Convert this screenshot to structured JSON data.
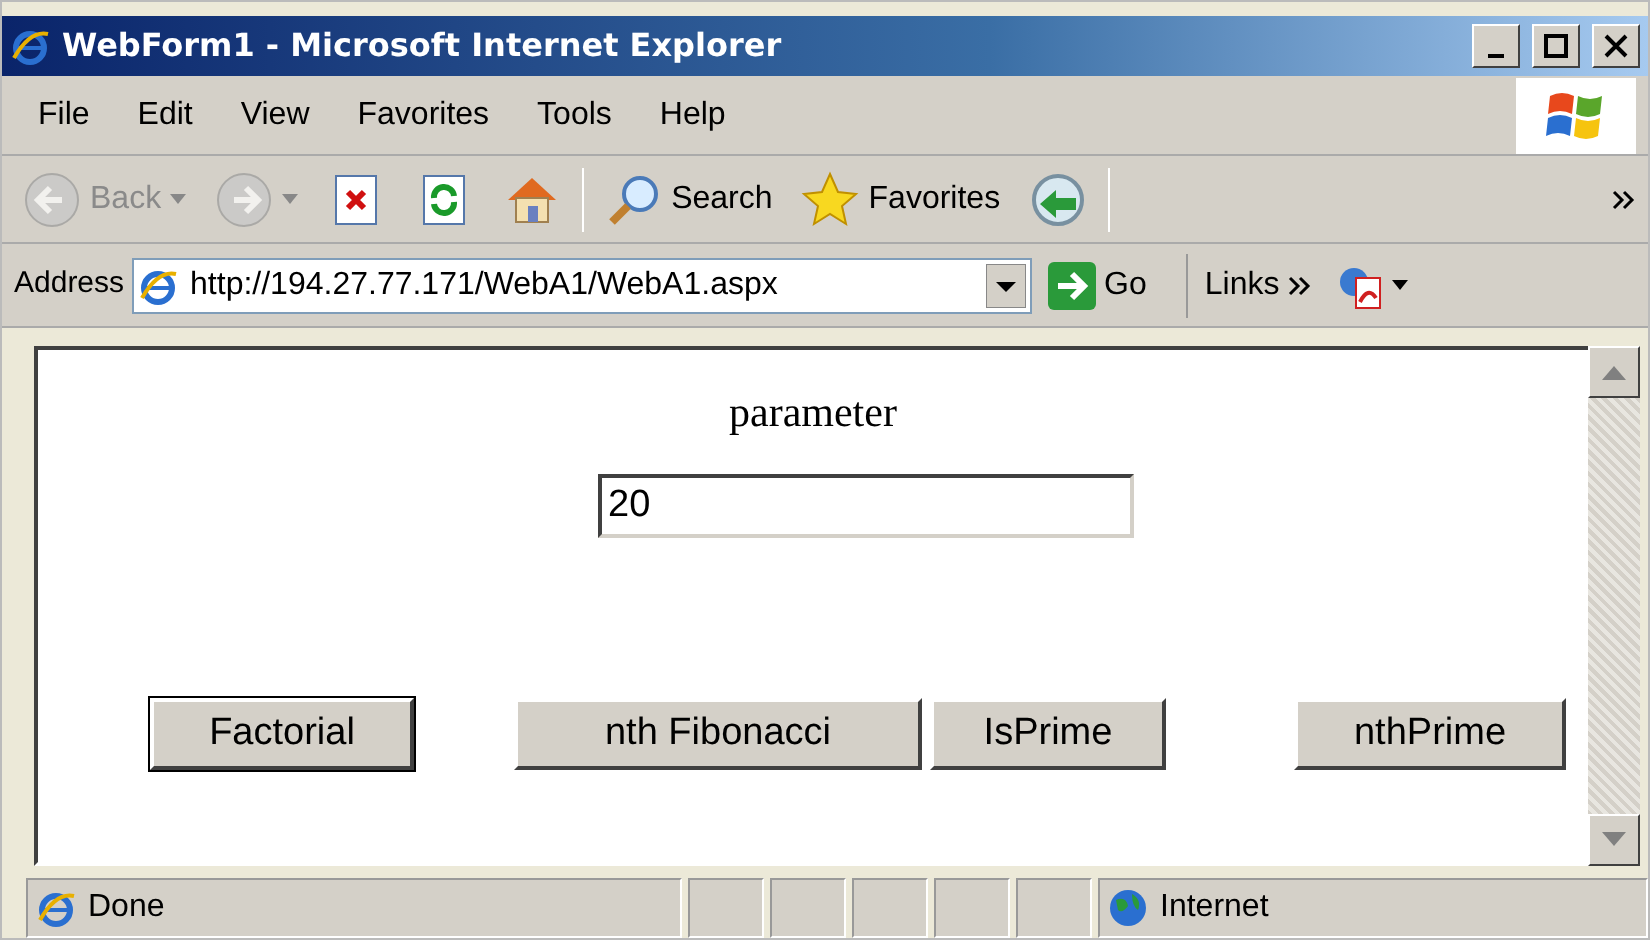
{
  "window": {
    "title": "WebForm1 - Microsoft Internet Explorer"
  },
  "menu": [
    "File",
    "Edit",
    "View",
    "Favorites",
    "Tools",
    "Help"
  ],
  "toolbar": [
    {
      "kind": "back",
      "label": "Back",
      "disabled": true
    },
    {
      "kind": "forward",
      "disabled": true
    },
    {
      "kind": "stop"
    },
    {
      "kind": "refresh"
    },
    {
      "kind": "home"
    },
    {
      "kind": "search",
      "label": "Search"
    },
    {
      "kind": "favorites",
      "label": "Favorites"
    },
    {
      "kind": "media"
    }
  ],
  "address": {
    "label": "Address",
    "value": "http://194.27.77.171/WebA1/WebA1.aspx",
    "go": "Go",
    "links": "Links"
  },
  "form": {
    "label": "parameter",
    "value": "20",
    "buttons": [
      {
        "label": "Factorial",
        "focused": true
      },
      {
        "label": "nth Fibonacci",
        "focused": false
      },
      {
        "label": "IsPrime",
        "focused": false
      },
      {
        "label": "nthPrime",
        "focused": false
      }
    ]
  },
  "status_bar": {
    "text": "Done",
    "zone": "Internet"
  }
}
